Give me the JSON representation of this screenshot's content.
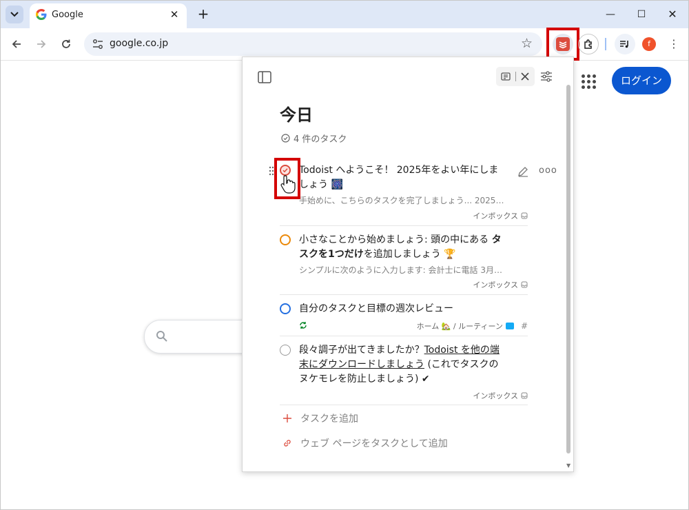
{
  "browser": {
    "tab_title": "Google",
    "url": "google.co.jp",
    "avatar_letter": "f"
  },
  "google": {
    "login_label": "ログイン"
  },
  "todoist": {
    "view_title": "今日",
    "task_count": "4 件のタスク",
    "tasks": [
      {
        "text": "Todoist へようこそ！ 2025年をよい年にしましょう 🎆",
        "description": "手始めに、こちらのタスクを完了しましょう... 2025…",
        "project": "インボックス",
        "priority_color": "#dc4c3e"
      },
      {
        "text_a": "小さなことから始めましょう: 頭の中にある ",
        "text_b": "タスクを1つだけ",
        "text_c": "を追加しましょう 🏆",
        "description": "シンプルに次のように入力します: 会計士に電話 3月…",
        "project": "インボックス",
        "priority_color": "#eb8909"
      },
      {
        "text": "自分のタスクと目標の週次レビュー",
        "project": "ホーム 🏡 / ルーティーン",
        "priority_color": "#246fe0"
      },
      {
        "text_a": "段々調子が出てきましたか？",
        "text_link": "Todoist を他の端末にダウンロードしましょう",
        "text_c": " (これでタスクのヌケモレを防止しましょう) ✔",
        "project": "インボックス",
        "priority_color": "#999999"
      }
    ],
    "add_task_label": "タスクを追加",
    "add_webpage_label": "ウェブ ページをタスクとして追加"
  },
  "colors": {
    "highlight": "#d40000",
    "todoist_red": "#dc4c3e",
    "google_blue": "#0b57d0"
  }
}
